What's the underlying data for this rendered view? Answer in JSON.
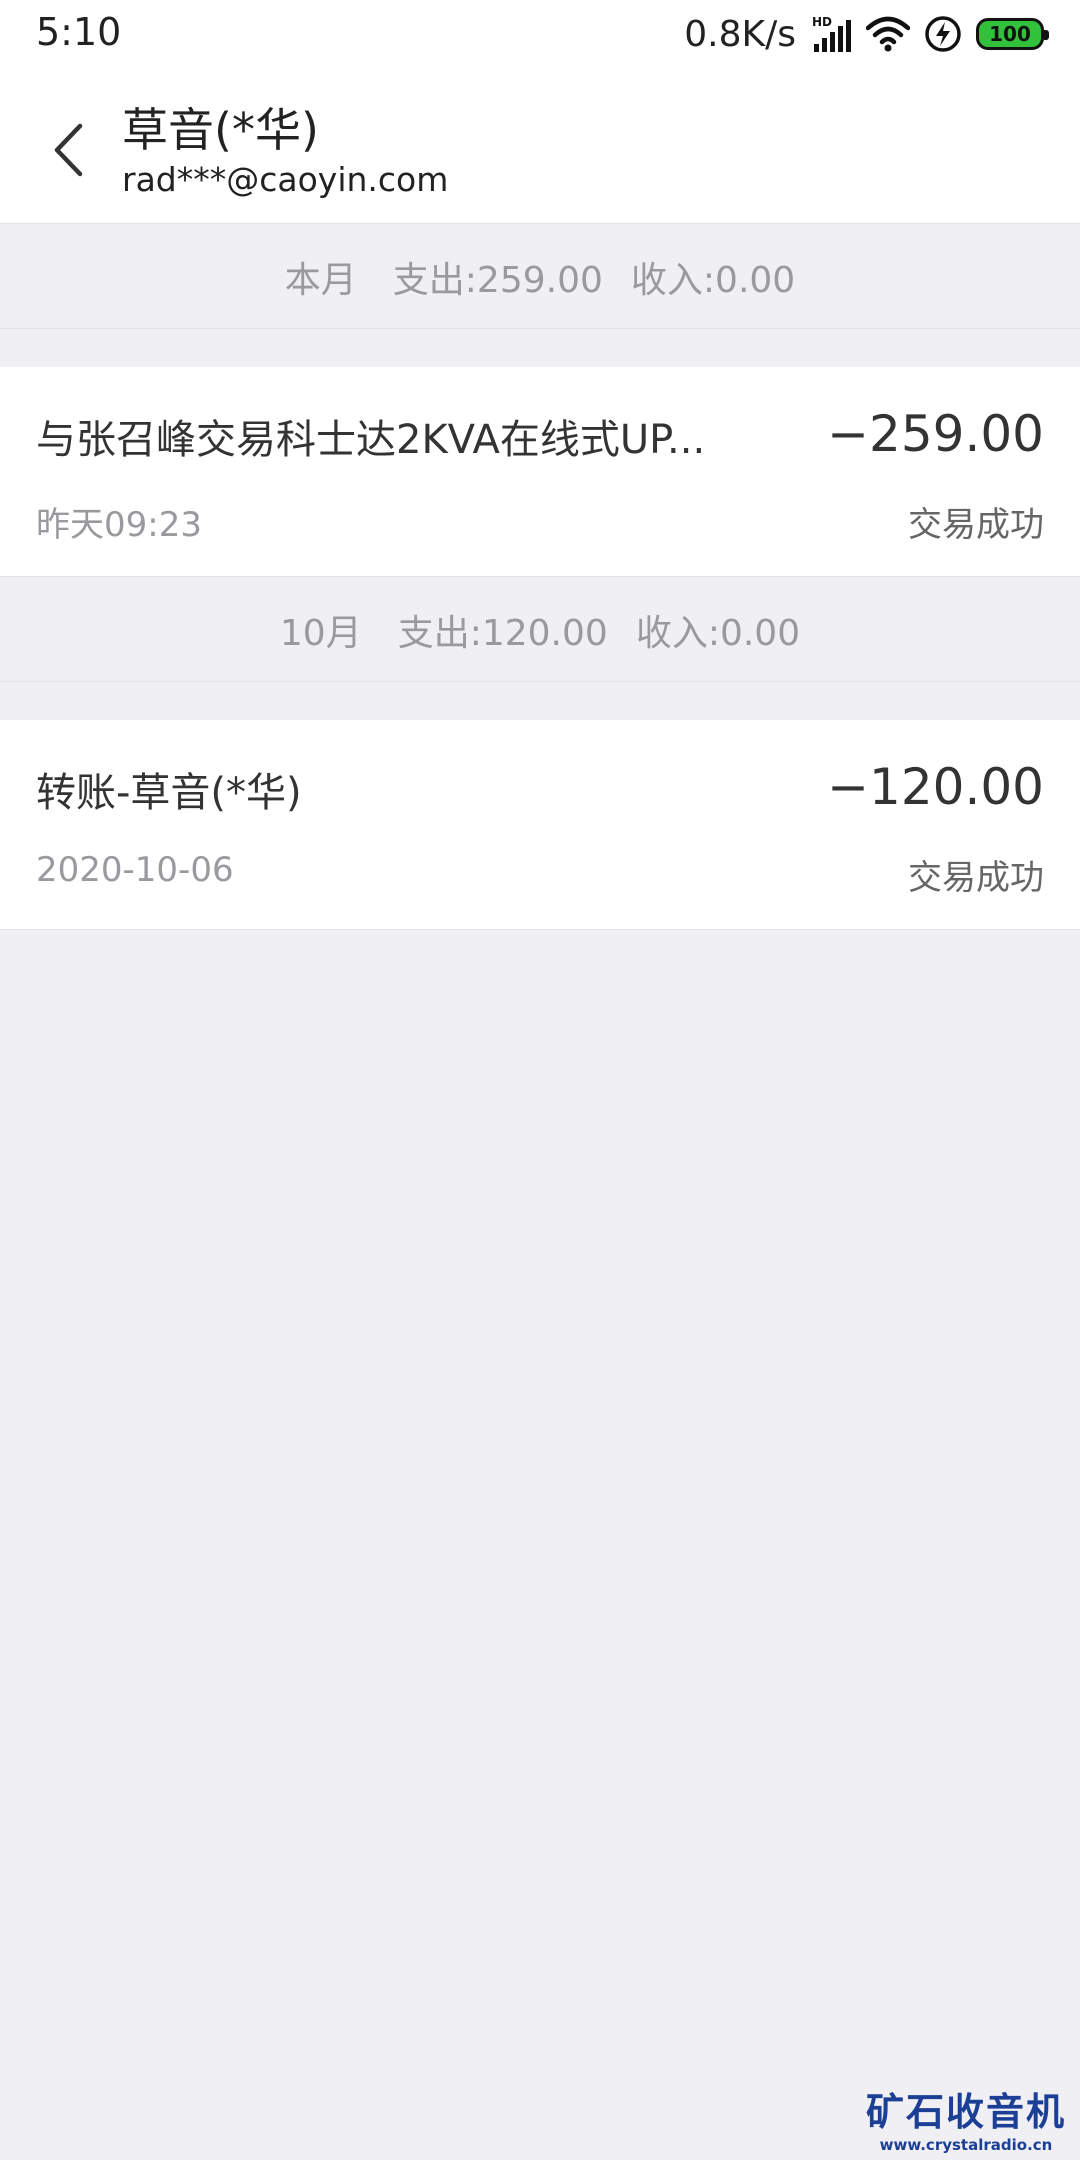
{
  "status_bar": {
    "time": "5:10",
    "net_speed": "0.8K/s",
    "signal_label": "HD",
    "battery": "100",
    "battery_color": "#32c13a"
  },
  "header": {
    "title": "草音(*华)",
    "subtitle": "rad***@caoyin.com",
    "back_icon": "chevron-left-icon"
  },
  "groups": [
    {
      "month": "本月",
      "expense": "支出:259.00",
      "income": "收入:0.00",
      "transactions": [
        {
          "title": "与张召峰交易科士达2KVA在线式UP...",
          "amount": "−259.00",
          "date": "昨天09:23",
          "status": "交易成功"
        }
      ]
    },
    {
      "month": "10月",
      "expense": "支出:120.00",
      "income": "收入:0.00",
      "transactions": [
        {
          "title": "转账-草音(*华)",
          "amount": "−120.00",
          "date": "2020-10-06",
          "status": "交易成功"
        }
      ]
    }
  ],
  "watermark": {
    "cn": "矿石收音机",
    "en": "www.crystalradio.cn",
    "color": "#1c3f96"
  }
}
